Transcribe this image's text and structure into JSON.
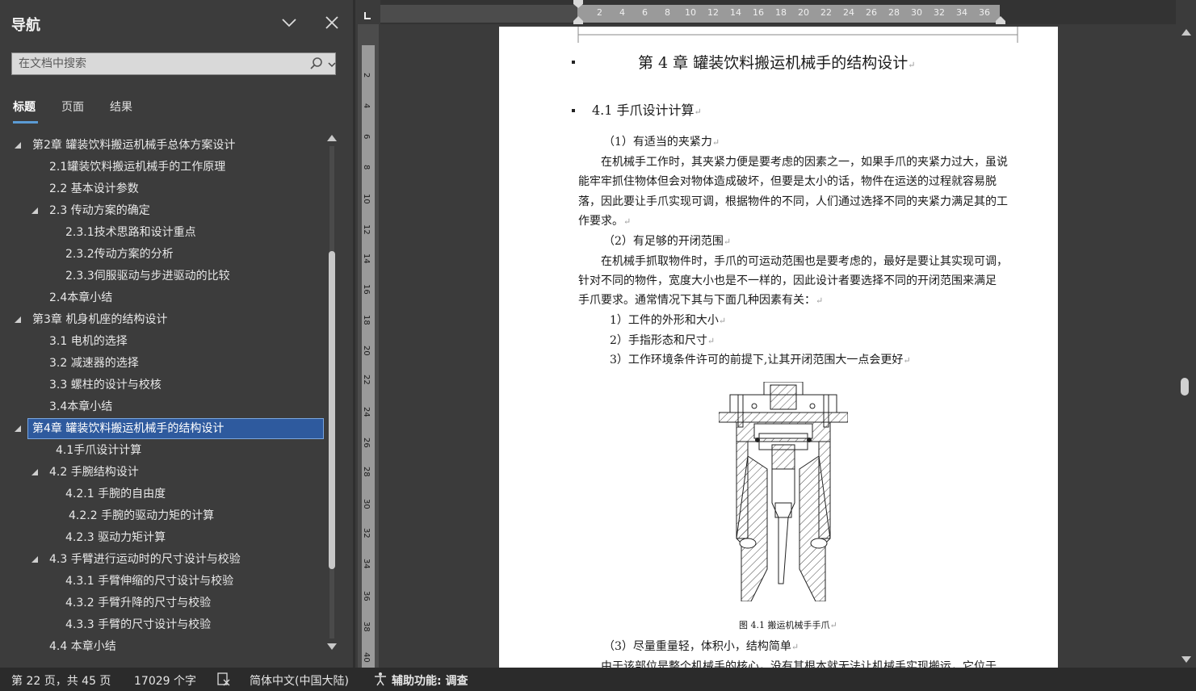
{
  "nav": {
    "title": "导航",
    "search_placeholder": "在文档中搜索",
    "tabs": [
      {
        "label": "标题",
        "active": true
      },
      {
        "label": "页面",
        "active": false
      },
      {
        "label": "结果",
        "active": false
      }
    ],
    "tree": [
      {
        "text": "第2章 罐装饮料搬运机械手总体方案设计",
        "expanded": true,
        "selected": false
      },
      {
        "text": "2.1罐装饮料搬运机械手的工作原理",
        "selected": false
      },
      {
        "text": "2.2  基本设计参数",
        "selected": false
      },
      {
        "text": "2.3  传动方案的确定",
        "expanded": true,
        "selected": false
      },
      {
        "text": "2.3.1技术思路和设计重点",
        "selected": false
      },
      {
        "text": "2.3.2传动方案的分析",
        "selected": false
      },
      {
        "text": "2.3.3伺服驱动与步进驱动的比较",
        "selected": false
      },
      {
        "text": "2.4本章小结",
        "selected": false
      },
      {
        "text": "第3章  机身机座的结构设计",
        "expanded": true,
        "selected": false
      },
      {
        "text": "3.1  电机的选择",
        "selected": false
      },
      {
        "text": "3.2 减速器的选择",
        "selected": false
      },
      {
        "text": "3.3  螺柱的设计与校核",
        "selected": false
      },
      {
        "text": "3.4本章小结",
        "selected": false
      },
      {
        "text": "第4章  罐装饮料搬运机械手的结构设计",
        "expanded": true,
        "selected": true
      },
      {
        "text": "4.1手爪设计计算",
        "selected": false
      },
      {
        "text": "4.2  手腕结构设计",
        "expanded": true,
        "selected": false
      },
      {
        "text": "4.2.1  手腕的自由度",
        "selected": false
      },
      {
        "text": "4.2.2  手腕的驱动力矩的计算",
        "selected": false
      },
      {
        "text": "4.2.3  驱动力矩计算",
        "selected": false
      },
      {
        "text": "4.3  手臂进行运动时的尺寸设计与校验",
        "expanded": true,
        "selected": false
      },
      {
        "text": "4.3.1 手臂伸缩的尺寸设计与校验",
        "selected": false
      },
      {
        "text": "4.3.2 手臂升降的尺寸与校验",
        "selected": false
      },
      {
        "text": "4.3.3 手臂的尺寸设计与校验",
        "selected": false
      },
      {
        "text": "4.4 本章小结",
        "selected": false
      }
    ]
  },
  "ruler": {
    "h_labels": [
      "2",
      "4",
      "6",
      "8",
      "10",
      "12",
      "14",
      "16",
      "18",
      "20",
      "22",
      "24",
      "26",
      "28",
      "30",
      "32",
      "34",
      "36"
    ],
    "v_labels": [
      "2",
      "4",
      "6",
      "8",
      "10",
      "12",
      "14",
      "16",
      "18",
      "20",
      "22",
      "24",
      "26",
      "28",
      "30",
      "32",
      "34",
      "36",
      "38",
      "40"
    ]
  },
  "doc": {
    "chapter_title": "第 4 章    罐装饮料搬运机械手的结构设计",
    "section_title": "4.1 手爪设计计算",
    "req1": "（1）有适当的夹紧力",
    "para1": [
      "在机械手工作时，其夹紧力便是要考虑的因素之一，如果手爪的夹紧力过大，虽说",
      "能牢牢抓住物体但会对物体造成破坏，但要是太小的话，物件在运送的过程就容易脱",
      "落，因此要让手爪实现可调，根据物件的不同，人们通过选择不同的夹紧力满足其的工",
      "作要求。"
    ],
    "req2": "（2）有足够的开闭范围",
    "para2": [
      "在机械手抓取物件时，手爪的可运动范围也是要考虑的，最好是要让其实现可调，",
      "针对不同的物件，宽度大小也是不一样的，因此设计者要选择不同的开闭范围来满足",
      "手爪要求。通常情况下其与下面几种因素有关："
    ],
    "factors": [
      "1）工件的外形和大小",
      "2）手指形态和尺寸",
      "3）工作环境条件许可的前提下,让其开闭范围大一点会更好"
    ],
    "figure_caption": "图 4.1  搬运机械手手爪",
    "req3": "（3）尽量重量轻，体积小，结构简单",
    "para3_partial": "由于该部位是整个机械手的核心，没有其根本就无法让机械手实现搬运，它位于",
    "para_mark": "↵"
  },
  "status": {
    "page": "第 22 页，共 45 页",
    "words": "17029 个字",
    "language": "简体中文(中国大陆)",
    "accessibility": "辅助功能: 调查"
  }
}
